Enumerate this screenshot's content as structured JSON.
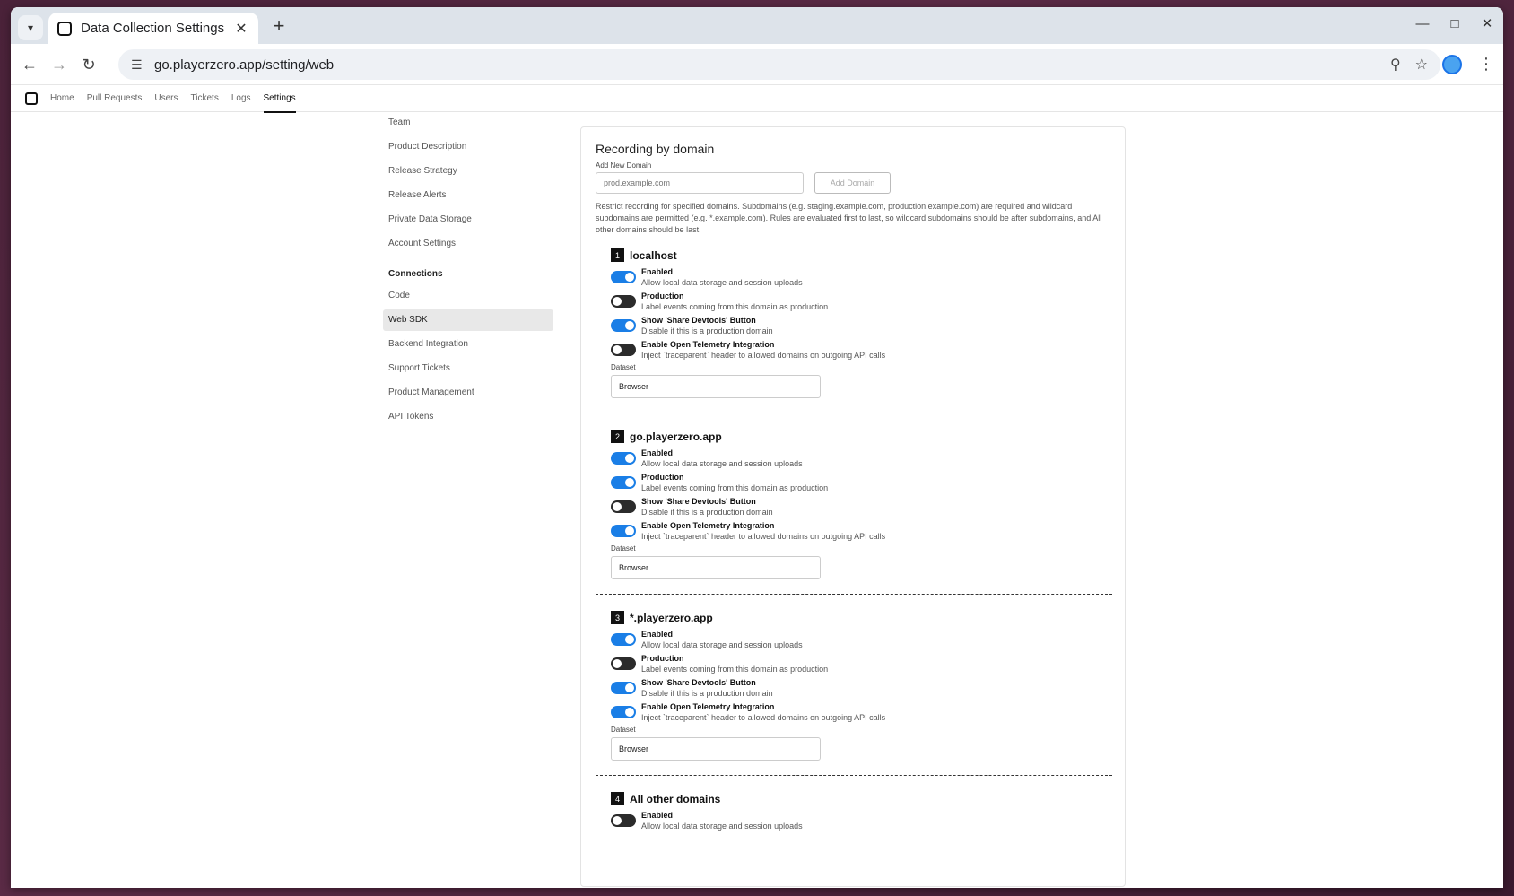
{
  "browser": {
    "tab_title": "Data Collection Settings",
    "url": "go.playerzero.app/setting/web"
  },
  "appnav": {
    "items": [
      "Home",
      "Pull Requests",
      "Users",
      "Tickets",
      "Logs",
      "Settings"
    ],
    "active": "Settings"
  },
  "sidenav": {
    "items_top": [
      "Team",
      "Product Description",
      "Release Strategy",
      "Release Alerts",
      "Private Data Storage",
      "Account Settings"
    ],
    "section": "Connections",
    "items_connections": [
      "Code",
      "Web SDK",
      "Backend Integration",
      "Support Tickets",
      "Product Management",
      "API Tokens"
    ],
    "active": "Web SDK"
  },
  "panel": {
    "title": "Recording by domain",
    "add_label": "Add New Domain",
    "add_placeholder": "prod.example.com",
    "add_button": "Add Domain",
    "help": "Restrict recording for specified domains. Subdomains (e.g. staging.example.com, production.example.com) are required and wildcard subdomains are permitted (e.g. *.example.com). Rules are evaluated first to last, so wildcard subdomains should be after subdomains, and All other domains should be last.",
    "dataset_label": "Dataset",
    "domains": [
      {
        "index": "1",
        "name": "localhost",
        "toggles": [
          {
            "label": "Enabled",
            "desc": "Allow local data storage and session uploads",
            "on": true
          },
          {
            "label": "Production",
            "desc": "Label events coming from this domain as production",
            "on": false
          },
          {
            "label": "Show 'Share Devtools' Button",
            "desc": "Disable if this is a production domain",
            "on": true
          },
          {
            "label": "Enable Open Telemetry Integration",
            "desc": "Inject `traceparent` header to allowed domains on outgoing API calls",
            "on": false
          }
        ],
        "dataset": "Browser"
      },
      {
        "index": "2",
        "name": "go.playerzero.app",
        "toggles": [
          {
            "label": "Enabled",
            "desc": "Allow local data storage and session uploads",
            "on": true
          },
          {
            "label": "Production",
            "desc": "Label events coming from this domain as production",
            "on": true
          },
          {
            "label": "Show 'Share Devtools' Button",
            "desc": "Disable if this is a production domain",
            "on": false
          },
          {
            "label": "Enable Open Telemetry Integration",
            "desc": "Inject `traceparent` header to allowed domains on outgoing API calls",
            "on": true
          }
        ],
        "dataset": "Browser"
      },
      {
        "index": "3",
        "name": "*.playerzero.app",
        "toggles": [
          {
            "label": "Enabled",
            "desc": "Allow local data storage and session uploads",
            "on": true
          },
          {
            "label": "Production",
            "desc": "Label events coming from this domain as production",
            "on": false
          },
          {
            "label": "Show 'Share Devtools' Button",
            "desc": "Disable if this is a production domain",
            "on": true
          },
          {
            "label": "Enable Open Telemetry Integration",
            "desc": "Inject `traceparent` header to allowed domains on outgoing API calls",
            "on": true
          }
        ],
        "dataset": "Browser"
      },
      {
        "index": "4",
        "name": "All other domains",
        "toggles": [
          {
            "label": "Enabled",
            "desc": "Allow local data storage and session uploads",
            "on": false
          }
        ]
      }
    ]
  },
  "colors": {
    "accent": "#1a7ee6",
    "toggle_off": "#2b2b2b"
  }
}
